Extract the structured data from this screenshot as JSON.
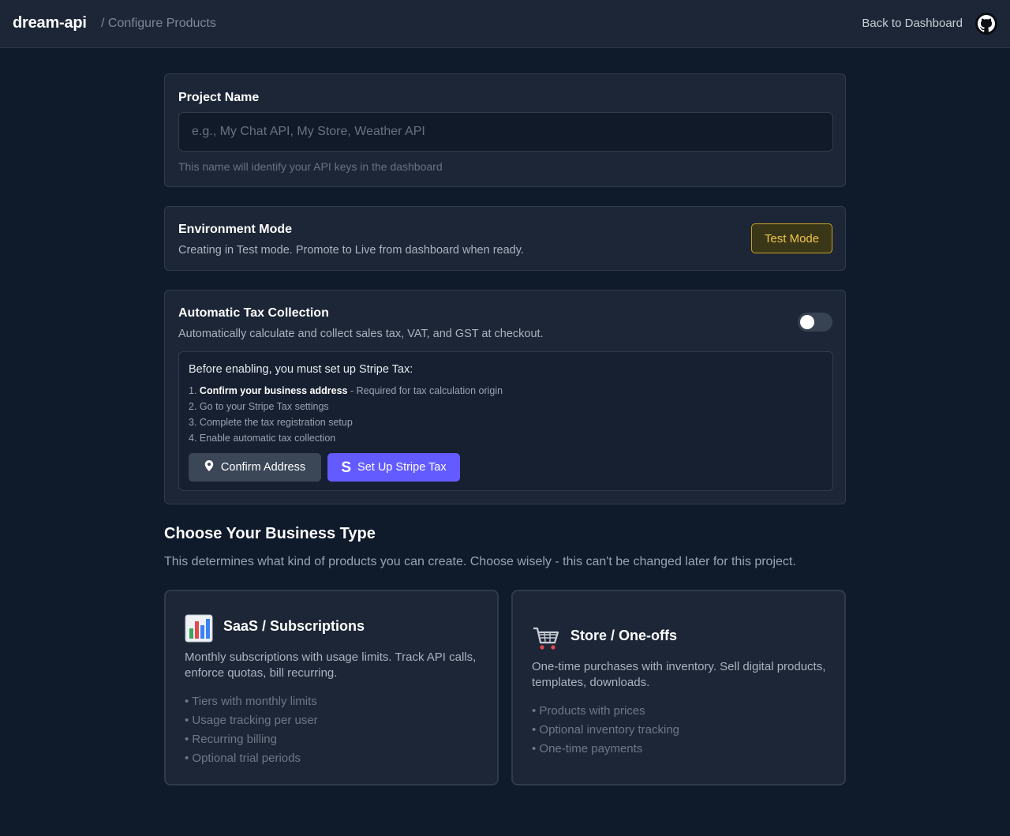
{
  "header": {
    "brand": "dream-api",
    "breadcrumb": "/ Configure Products",
    "back_link": "Back to Dashboard",
    "avatar_icon": "github-icon"
  },
  "project_name": {
    "label": "Project Name",
    "placeholder": "e.g., My Chat API, My Store, Weather API",
    "value": "",
    "hint": "This name will identify your API keys in the dashboard"
  },
  "environment": {
    "title": "Environment Mode",
    "description": "Creating in Test mode. Promote to Live from dashboard when ready.",
    "mode_button": "Test Mode",
    "accent_color": "#f2c54a"
  },
  "tax": {
    "title": "Automatic Tax Collection",
    "description": "Automatically calculate and collect sales tax, VAT, and GST at checkout.",
    "enabled": false,
    "setup_heading": "Before enabling, you must set up Stripe Tax:",
    "steps": [
      {
        "num": "1.",
        "bold": "Confirm your business address",
        "text": " - Required for tax calculation origin"
      },
      {
        "num": "2.",
        "bold": "",
        "text": "Go to your Stripe Tax settings"
      },
      {
        "num": "3.",
        "bold": "",
        "text": "Complete the tax registration setup"
      },
      {
        "num": "4.",
        "bold": "",
        "text": "Enable automatic tax collection"
      }
    ],
    "confirm_button": "Confirm Address",
    "stripe_button": "Set Up Stripe Tax",
    "stripe_color": "#635bff"
  },
  "business": {
    "title": "Choose Your Business Type",
    "description": "This determines what kind of products you can create. Choose wisely - this can't be changed later for this project.",
    "options": [
      {
        "icon": "bar-chart-icon",
        "title": "SaaS / Subscriptions",
        "description": "Monthly subscriptions with usage limits. Track API calls, enforce quotas, bill recurring.",
        "features": [
          "Tiers with monthly limits",
          "Usage tracking per user",
          "Recurring billing",
          "Optional trial periods"
        ]
      },
      {
        "icon": "shopping-cart-icon",
        "title": "Store / One-offs",
        "description": "One-time purchases with inventory. Sell digital products, templates, downloads.",
        "features": [
          "Products with prices",
          "Optional inventory tracking",
          "One-time payments"
        ]
      }
    ]
  }
}
